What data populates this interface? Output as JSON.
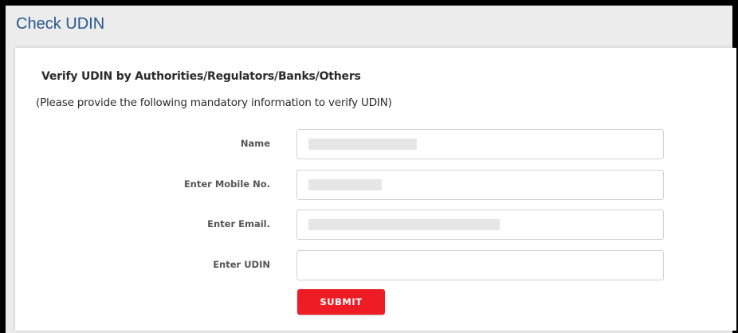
{
  "page": {
    "title": "Check UDIN"
  },
  "card": {
    "heading": "Verify UDIN by Authorities/Regulators/Banks/Others",
    "note": "(Please provide the following mandatory information to verify UDIN)"
  },
  "form": {
    "fields": [
      {
        "label": "Name",
        "value": ""
      },
      {
        "label": "Enter Mobile No.",
        "value": ""
      },
      {
        "label": "Enter Email.",
        "value": ""
      },
      {
        "label": "Enter UDIN",
        "value": ""
      }
    ],
    "submit_label": "SUBMIT"
  },
  "colors": {
    "title": "#2a5690",
    "submit": "#ee1c24",
    "background": "#ececec"
  }
}
